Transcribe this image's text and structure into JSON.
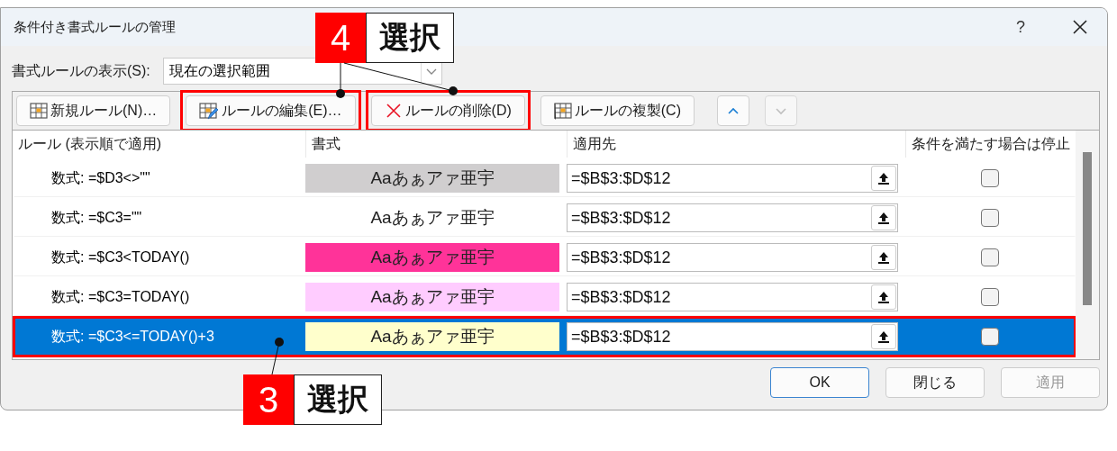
{
  "window": {
    "title": "条件付き書式ルールの管理",
    "help": "?"
  },
  "show_rules": {
    "label": "書式ルールの表示(S):",
    "value": "現在の選択範囲"
  },
  "toolbar": [
    {
      "kind": "new",
      "label": "新規ルール(N)…",
      "highlighted": false
    },
    {
      "kind": "edit",
      "label": "ルールの編集(E)…",
      "highlighted": true
    },
    {
      "kind": "delete",
      "label": "ルールの削除(D)",
      "highlighted": true
    },
    {
      "kind": "copy",
      "label": "ルールの複製(C)",
      "highlighted": false
    },
    {
      "kind": "up",
      "disabled": false
    },
    {
      "kind": "down",
      "disabled": true
    }
  ],
  "table": {
    "columns": [
      "ルール (表示順で適用)",
      "書式",
      "適用先",
      "条件を満たす場合は停止"
    ],
    "rows": [
      {
        "rule": "数式: =$D3<>\"\"",
        "preview": "Aaあぁアァ亜宇",
        "color": "#d0cecf",
        "applies_to": "=$B$3:$D$12",
        "stop": false,
        "selected": false,
        "highlighted": false
      },
      {
        "rule": "数式: =$C3=\"\"",
        "preview": "Aaあぁアァ亜宇",
        "color": "#ffffff",
        "applies_to": "=$B$3:$D$12",
        "stop": false,
        "selected": false,
        "highlighted": false
      },
      {
        "rule": "数式: =$C3<TODAY()",
        "preview": "Aaあぁアァ亜宇",
        "color": "#ff3399",
        "applies_to": "=$B$3:$D$12",
        "stop": false,
        "selected": false,
        "highlighted": false
      },
      {
        "rule": "数式: =$C3=TODAY()",
        "preview": "Aaあぁアァ亜宇",
        "color": "#ffccff",
        "applies_to": "=$B$3:$D$12",
        "stop": false,
        "selected": false,
        "highlighted": false
      },
      {
        "rule": "数式: =$C3<=TODAY()+3",
        "preview": "Aaあぁアァ亜宇",
        "color": "#ffffcc",
        "applies_to": "=$B$3:$D$12",
        "stop": false,
        "selected": true,
        "highlighted": true
      }
    ]
  },
  "buttons": [
    {
      "label": "OK",
      "default": true,
      "disabled": false
    },
    {
      "label": "閉じる",
      "default": false,
      "disabled": false
    },
    {
      "label": "適用",
      "default": false,
      "disabled": true
    }
  ],
  "callouts": [
    {
      "number": "4",
      "label": "選択"
    },
    {
      "number": "3",
      "label": "選択"
    }
  ]
}
